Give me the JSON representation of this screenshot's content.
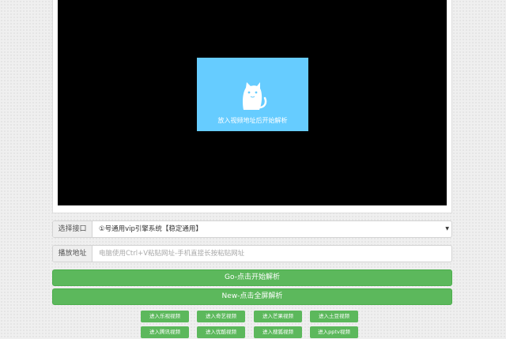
{
  "player": {
    "overlay_text": "放入视频地址后开始解析"
  },
  "form": {
    "select_label": "选择接口",
    "select_value": "①号通用vip引擎系统【稳定通用】",
    "address_label": "播放地址",
    "address_placeholder": "电脑使用Ctrl+V粘贴网址-手机直接长按粘贴网址"
  },
  "buttons": {
    "parse": "Go-点击开始解析",
    "fullscreen": "New-点击全屏解析"
  },
  "video_sites": [
    "进入乐视视频",
    "进入奇艺视频",
    "进入芒果视频",
    "进入土豆视频",
    "进入腾讯视频",
    "进入优酷视频",
    "进入搜狐视频",
    "进入pptv视频"
  ],
  "colors": {
    "overlay": "#66ccff",
    "button": "#5cb85c",
    "player_bg": "#000000"
  },
  "icons": {
    "overlay": "cat-icon",
    "select": "caret-down-icon"
  }
}
